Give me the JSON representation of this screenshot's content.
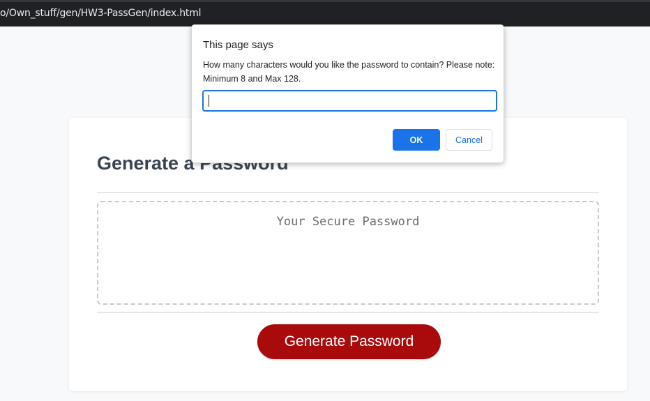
{
  "browser": {
    "url": "o/Own_stuff/gen/HW3-PassGen/index.html"
  },
  "page": {
    "title": "Generate a Password",
    "password_placeholder": "Your Secure Password",
    "password_value": "",
    "generate_label": "Generate Password",
    "colors": {
      "button": "#a90b0d",
      "background": "#f8f9fa",
      "card": "#ffffff"
    }
  },
  "dialog": {
    "title": "This page says",
    "message": "How many characters would you like the password to contain?  Please note: Minimum 8 and Max 128.",
    "input_value": "",
    "ok_label": "OK",
    "cancel_label": "Cancel",
    "accent": "#1a73e8"
  }
}
